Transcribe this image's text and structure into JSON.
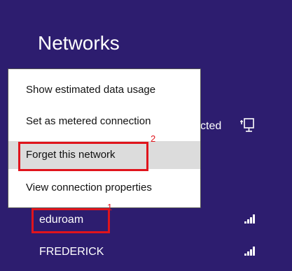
{
  "panel": {
    "title": "Networks",
    "connected_fragment": "cted",
    "networks": [
      {
        "name": "eduroam",
        "icon": "wifi-signal-icon"
      },
      {
        "name": "FREDERICK",
        "icon": "wifi-signal-icon"
      }
    ]
  },
  "context_menu": {
    "items": [
      {
        "label": "Show estimated data usage"
      },
      {
        "label": "Set as metered connection"
      },
      {
        "label": "Forget this network"
      },
      {
        "label": "View connection properties"
      }
    ]
  },
  "annotations": {
    "callout_1_number": "1",
    "callout_2_number": "2"
  },
  "colors": {
    "panel_bg": "#2d1d6f",
    "menu_bg": "#ffffff",
    "menu_highlight": "#dcdcdc",
    "callout": "#e0141c",
    "text_light": "#ffffff",
    "text_dark": "#111111"
  }
}
